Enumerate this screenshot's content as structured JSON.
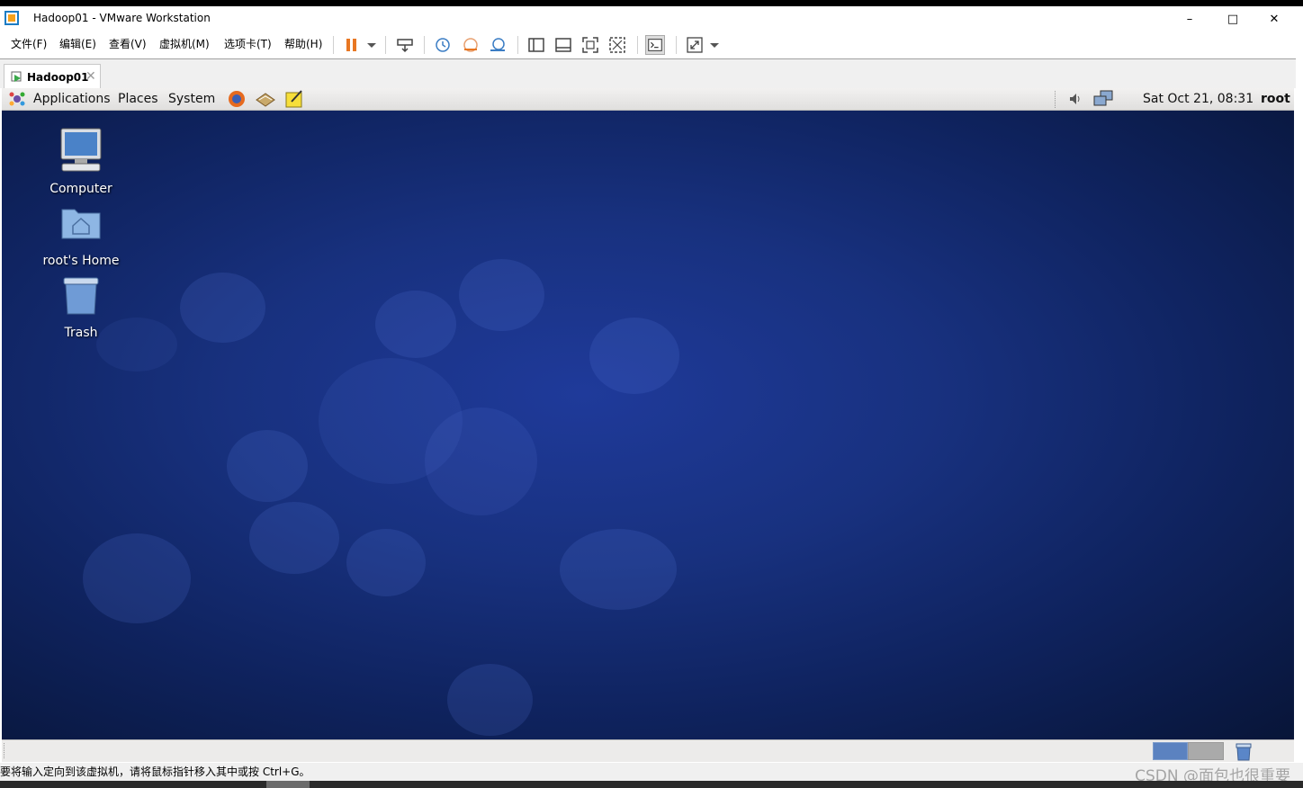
{
  "window": {
    "title": "Hadoop01 - VMware Workstation"
  },
  "menu": [
    "文件(F)",
    "编辑(E)",
    "查看(V)",
    "虚拟机(M)",
    "选项卡(T)",
    "帮助(H)"
  ],
  "tab": {
    "label": "Hadoop01"
  },
  "gnome_panel": {
    "menus": [
      "Applications",
      "Places",
      "System"
    ],
    "clock": "Sat Oct 21, 08:31",
    "user": "root"
  },
  "desktop_icons": [
    "Computer",
    "root's Home",
    "Trash"
  ],
  "status": {
    "text": "要将输入定向到该虚拟机，请将鼠标指针移入其中或按 Ctrl+G。"
  },
  "watermark": "CSDN @面包也很重要",
  "colors": {
    "desktop_bg": "#1a2f80",
    "accent_pause": "#e87722"
  }
}
